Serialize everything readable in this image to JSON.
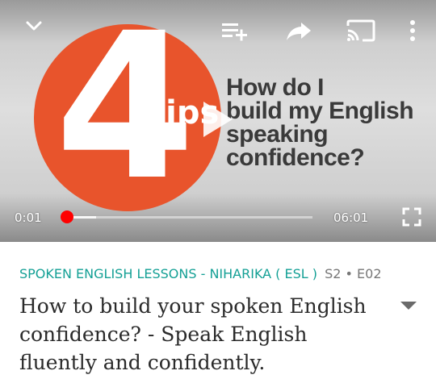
{
  "thumbnail": {
    "number": "4",
    "tips_word": "tips",
    "headline_lines": [
      "How do I",
      "build my English",
      "speaking",
      "confidence?"
    ]
  },
  "player": {
    "current_time": "0:01",
    "total_time": "06:01",
    "progress_fraction": 0.003,
    "buffered_fraction": 0.12,
    "icons": [
      "chevron-down-icon",
      "add-to-queue-icon",
      "share-icon",
      "cast-icon",
      "more-vert-icon",
      "play-icon",
      "fullscreen-icon"
    ]
  },
  "info": {
    "series_name": "SPOKEN ENGLISH LESSONS - NIHARIKA ( ESL )",
    "episode": "S2 • E02",
    "title": "How to build your spoken English confidence? - Speak English fluently and confidently."
  },
  "colors": {
    "accent_red": "#ff0000",
    "series_teal": "#14a095",
    "thumbnail_orange": "#e8542c"
  }
}
